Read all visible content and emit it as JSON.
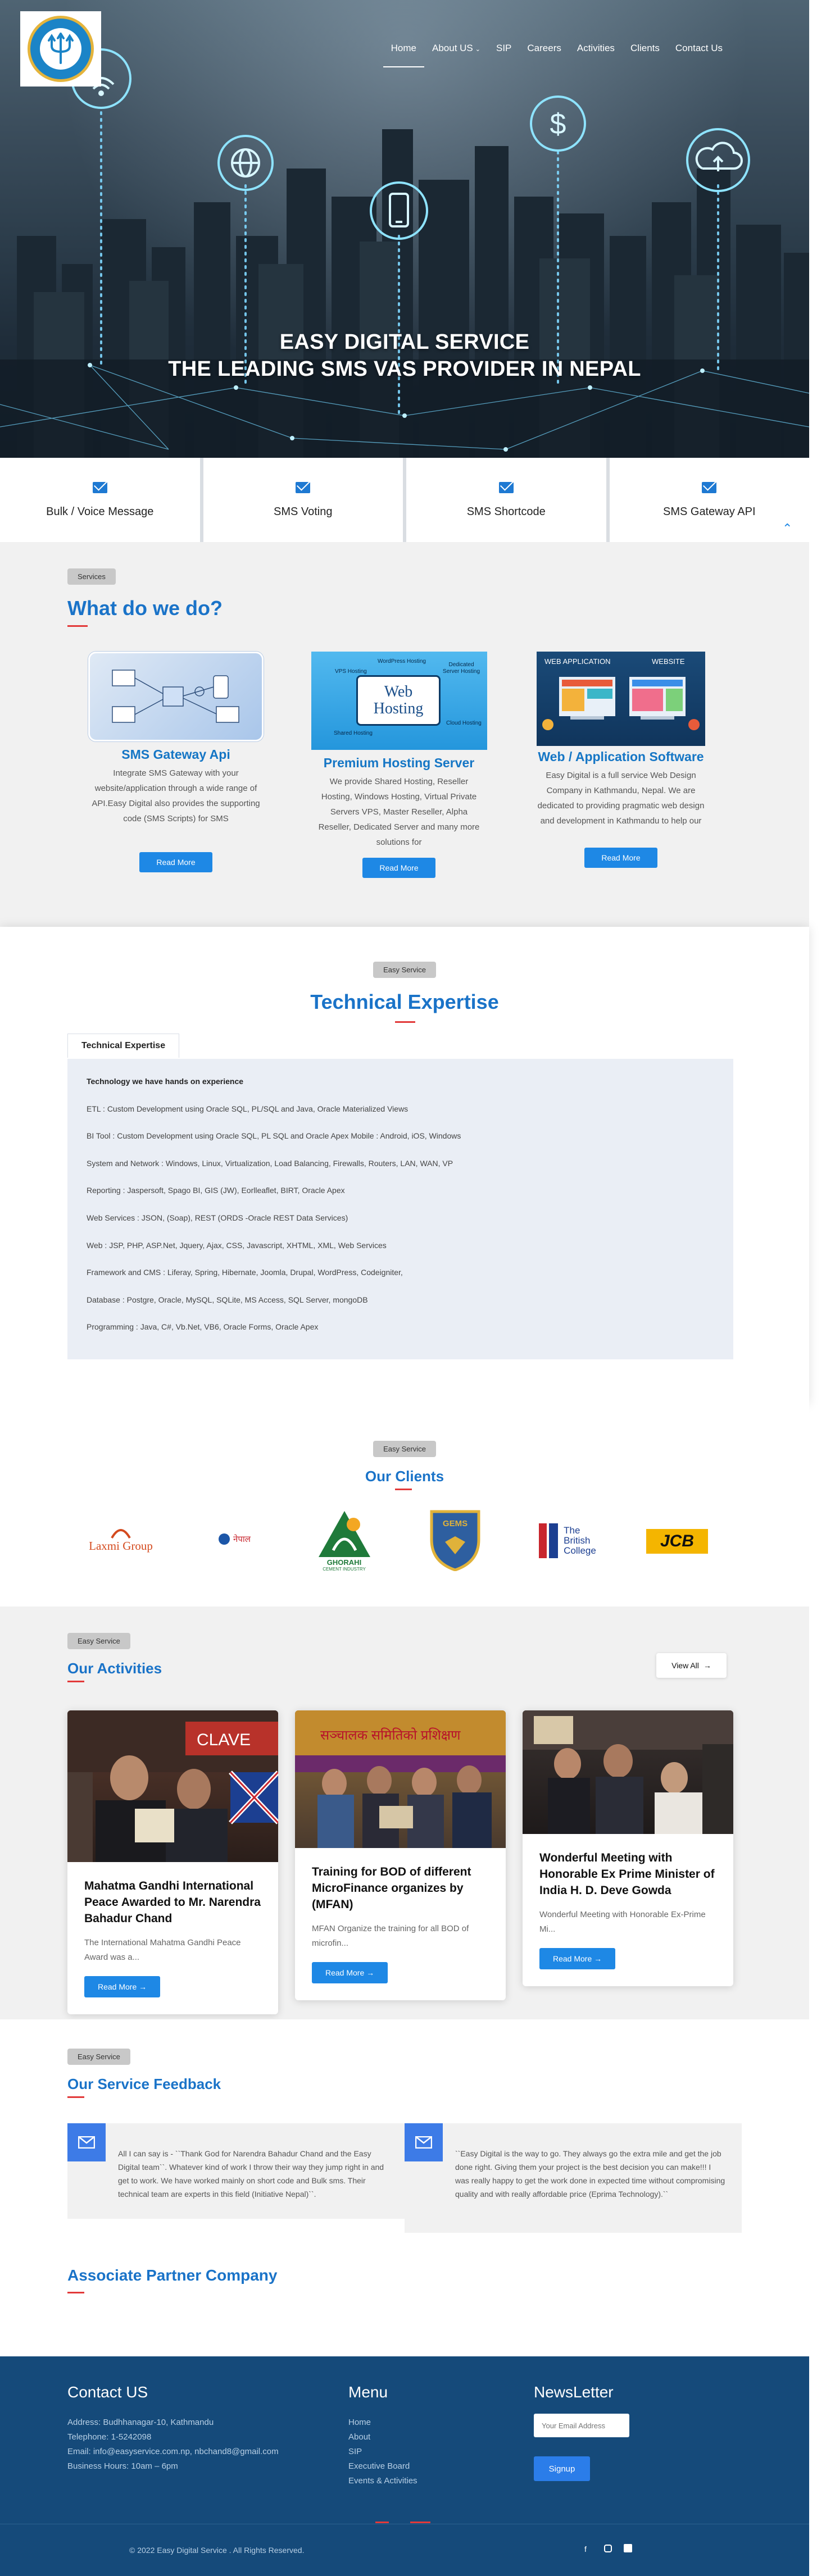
{
  "brand": {
    "logo_alt": "Easy Digital Service logo"
  },
  "nav": {
    "items": [
      {
        "label": "Home",
        "active": true
      },
      {
        "label": "About US",
        "dropdown": true
      },
      {
        "label": "SIP"
      },
      {
        "label": "Careers"
      },
      {
        "label": "Activities"
      },
      {
        "label": "Clients"
      },
      {
        "label": "Contact Us"
      }
    ]
  },
  "hero": {
    "line1": "EASY DIGITAL SERVICE",
    "line2": "THE LEADING SMS VAS PROVIDER IN NEPAL"
  },
  "service_tabs": [
    {
      "label": "Bulk / Voice Message",
      "icon": "envelope-icon"
    },
    {
      "label": "SMS Voting",
      "icon": "envelope-icon"
    },
    {
      "label": "SMS Shortcode",
      "icon": "envelope-icon"
    },
    {
      "label": "SMS Gateway API",
      "icon": "envelope-icon"
    }
  ],
  "services": {
    "pill": "Services",
    "heading": "What do we do?",
    "cards": [
      {
        "title": "SMS Gateway Api",
        "text": "Integrate SMS Gateway with your website/application through a wide range of API.Easy Digital also provides the supporting code (SMS Scripts) for SMS",
        "button": "Read More"
      },
      {
        "title": "Premium Hosting Server",
        "text": "We provide Shared Hosting, Reseller Hosting, Windows Hosting, Virtual Private Servers VPS, Master Reseller, Alpha Reseller, Dedicated Server and many more solutions for",
        "button": "Read More",
        "img_title": "Web Hosting",
        "img_labels": [
          "VPS Hosting",
          "Shared Hosting",
          "Cloud Hosting",
          "Dedicated Server Hosting",
          "WordPress Hosting"
        ]
      },
      {
        "title": "Web / Application Software",
        "text": "Easy Digital is a full service Web Design Company in Kathmandu, Nepal. We are dedicated to providing pragmatic web design and development in Kathmandu to help our",
        "button": "Read More",
        "img_labels": [
          "WEB APPLICATION",
          "WEBSITE"
        ]
      }
    ]
  },
  "tech": {
    "pill": "Easy Service",
    "heading": "Technical Expertise",
    "tab": "Technical Expertise",
    "lines": [
      "Technology we have hands on experience",
      "ETL :  Custom  Development  using  Oracle  SQL,  PL/SQL  and  Java,  Oracle Materialized Views",
      "BI Tool : Custom Development using Oracle SQL, PL SQL and Oracle Apex Mobile : Android, iOS, Windows",
      "System and Network : Windows, Linux, Virtualization, Load Balancing, Firewalls, Routers, LAN, WAN, VP",
      "Reporting : Jaspersoft, Spago BI, GIS (JW), Eorlleaflet, BIRT, Oracle Apex",
      "Web Services : JSON, (Soap), REST (ORDS -Oracle REST Data Services)",
      "Web : JSP, PHP, ASP.Net, Jquery, Ajax, CSS, Javascript, XHTML, XML, Web Services",
      "Framework and CMS : Liferay, Spring, Hibernate, Joomla, Drupal, WordPress, Codeigniter,",
      "Database : Postgre, Oracle, MySQL, SQLite, MS Access, SQL Server, mongoDB",
      "Programming : Java, C#, Vb.Net, VB6, Oracle Forms, Oracle Apex"
    ]
  },
  "clients": {
    "pill": "Easy Service",
    "heading": "Our Clients",
    "logos": [
      {
        "name": "Laxmi Group",
        "text": "Laxmi Group"
      },
      {
        "name": "Nepali company",
        "text": "नेपाल"
      },
      {
        "name": "Ghorahi Cement",
        "text": "GHORAHI",
        "sub": "CEMENT INDUSTRY"
      },
      {
        "name": "GEMS",
        "text": "GEMS"
      },
      {
        "name": "The British College",
        "text1": "The",
        "text2": "British",
        "text3": "College"
      },
      {
        "name": "JCB",
        "text": "JCB"
      }
    ]
  },
  "activities": {
    "pill": "Easy Service",
    "heading": "Our Activities",
    "view_all": "View All",
    "cards": [
      {
        "title": "Mahatma Gandhi International Peace Awarded to Mr. Narendra Bahadur Chand",
        "text": "The International Mahatma Gandhi Peace Award was a...",
        "button": "Read More"
      },
      {
        "title": "Training for BOD of different MicroFinance organizes by (MFAN)",
        "text": "MFAN Organize the training for all BOD of microfin...",
        "button": "Read More"
      },
      {
        "title": "Wonderful Meeting with Honorable Ex Prime Minister of India H. D. Deve Gowda",
        "text": "Wonderful Meeting with Honorable Ex-Prime Mi...",
        "button": "Read More"
      }
    ]
  },
  "feedback": {
    "pill": "Easy Service",
    "heading": "Our Service Feedback",
    "items": [
      {
        "text": "All I can say is - ``Thank God for Narendra Bahadur Chand and the Easy Digital team``. Whatever kind of work I throw their way they jump right in and get to work. We have worked mainly on short code and Bulk sms. Their technical team are experts in this field (Initiative Nepal)``."
      },
      {
        "text": "``Easy Digital is the way to go. They always go the extra mile and get the job done right. Giving them your project is the best decision you can make!!! I was really happy to get the work done in expected time without compromising quality and with really affordable price (Eprima Technology).``"
      }
    ]
  },
  "partners": {
    "heading": "Associate Partner Company"
  },
  "footer": {
    "contact_title": "Contact US",
    "address": "Address: Budhhanagar-10, Kathmandu",
    "phone": "Telephone: 1-5242098",
    "email": "Email: info@easyservice.com.np, nbchand8@gmail.com",
    "hours": "Business Hours: 10am – 6pm",
    "menu_title": "Menu",
    "menu": [
      "Home",
      "About",
      "SIP",
      "Executive Board",
      "Events & Activities"
    ],
    "news_title": "NewsLetter",
    "email_placeholder": "Your Email Address",
    "signup": "Signup",
    "copyright": "© 2022 Easy Digital Service . All Rights Reserved."
  },
  "colors": {
    "accent": "#1e88e5",
    "heading_blue": "#1a73c8",
    "red": "#e23a3a",
    "footer": "#154a7a"
  }
}
